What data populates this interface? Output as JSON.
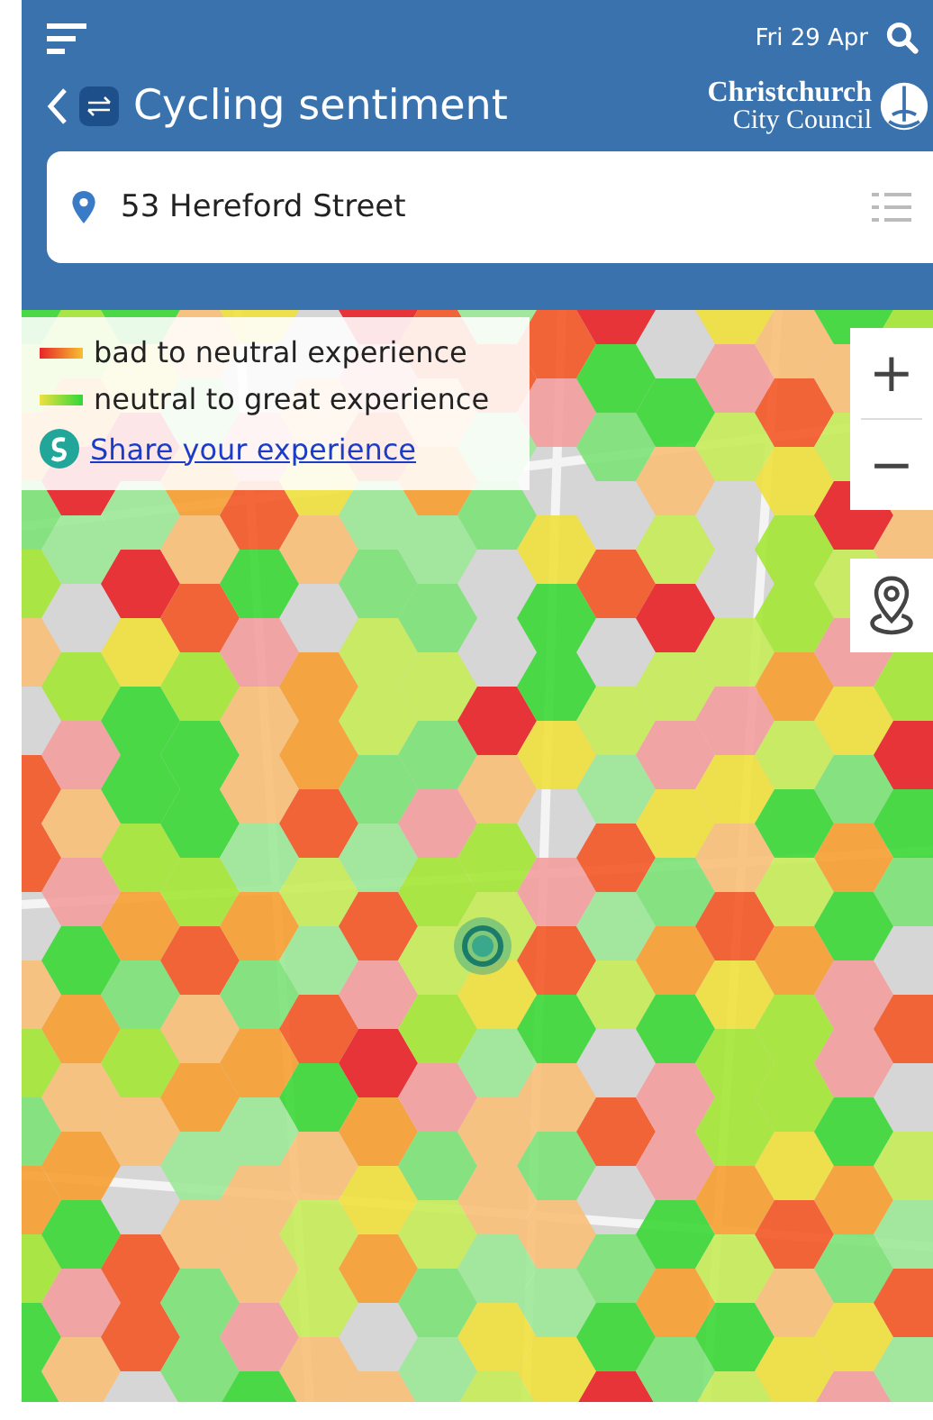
{
  "header": {
    "date": "Fri 29 Apr",
    "title": "Cycling sentiment",
    "logo_lines": [
      "Christchurch",
      "City Council"
    ]
  },
  "search": {
    "value": "53 Hereford Street"
  },
  "legend": {
    "items": [
      {
        "kind": "bad",
        "label": "bad to neutral experience"
      },
      {
        "kind": "good",
        "label": "neutral to great experience"
      }
    ],
    "link": "Share your experience"
  },
  "map_controls": {
    "zoom_in": "+",
    "zoom_out": "−"
  }
}
